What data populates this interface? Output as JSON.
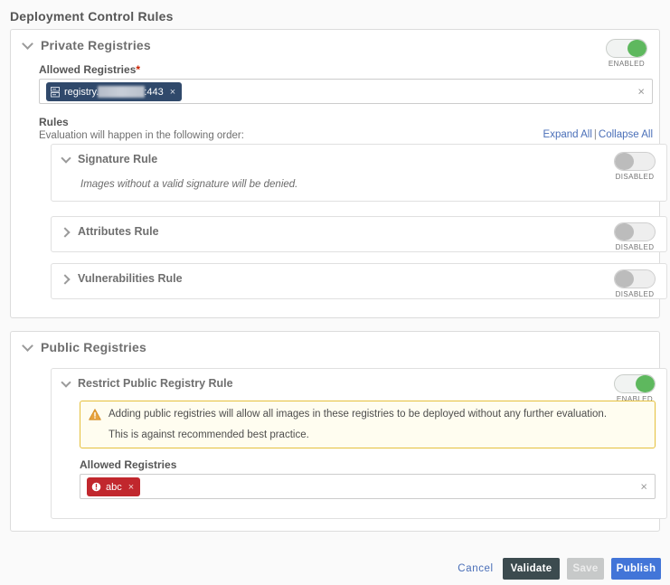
{
  "page": {
    "title": "Deployment Control Rules"
  },
  "private": {
    "section_title": "Private Registries",
    "toggle": {
      "state": "on",
      "label": "ENABLED"
    },
    "allowed_label": "Allowed Registries",
    "required_marker": "*",
    "chip": {
      "icon": "server-icon",
      "prefix": "registry.",
      "redacted": true,
      "suffix": ":443",
      "remove": "×"
    },
    "clear_icon": "×",
    "rules_title": "Rules",
    "rules_subtitle": "Evaluation will happen in the following order:",
    "expand_all": "Expand All",
    "link_separator": "|",
    "collapse_all": "Collapse All",
    "rules": [
      {
        "name": "Signature Rule",
        "expanded": true,
        "chevron": "chevron-down-icon",
        "description": "Images without a valid signature will be denied.",
        "toggle": {
          "state": "off",
          "label": "DISABLED"
        }
      },
      {
        "name": "Attributes Rule",
        "expanded": false,
        "chevron": "chevron-right-icon",
        "description": "",
        "toggle": {
          "state": "off",
          "label": "DISABLED"
        }
      },
      {
        "name": "Vulnerabilities Rule",
        "expanded": false,
        "chevron": "chevron-right-icon",
        "description": "",
        "toggle": {
          "state": "off",
          "label": "DISABLED"
        }
      }
    ]
  },
  "public": {
    "section_title": "Public Registries",
    "rule": {
      "name": "Restrict Public Registry Rule",
      "chevron": "chevron-down-icon",
      "toggle": {
        "state": "on",
        "label": "ENABLED"
      }
    },
    "warning": {
      "icon": "warning-triangle-icon",
      "line1": "Adding public registries will allow all images in these registries to be deployed without any further evaluation.",
      "line2": "This is against recommended best practice."
    },
    "allowed_label": "Allowed Registries",
    "chip": {
      "icon": "error-circle-icon",
      "text": "abc",
      "remove": "×"
    },
    "clear_icon": "×"
  },
  "footer": {
    "cancel": "Cancel",
    "validate": "Validate",
    "save": "Save",
    "publish": "Publish"
  },
  "colors": {
    "accent_blue": "#4275d8",
    "link_blue": "#4a6fb8",
    "validate_dark": "#3c4b4f",
    "save_muted": "#c7c9c9",
    "toggle_on_green": "#5eb85e",
    "toggle_off_gray": "#bcbcbc",
    "chip_navy": "#30496b",
    "chip_red": "#c1272d",
    "warning_border": "#e5c03c",
    "warning_bg": "#fffdf0",
    "required_red": "#c92100"
  }
}
